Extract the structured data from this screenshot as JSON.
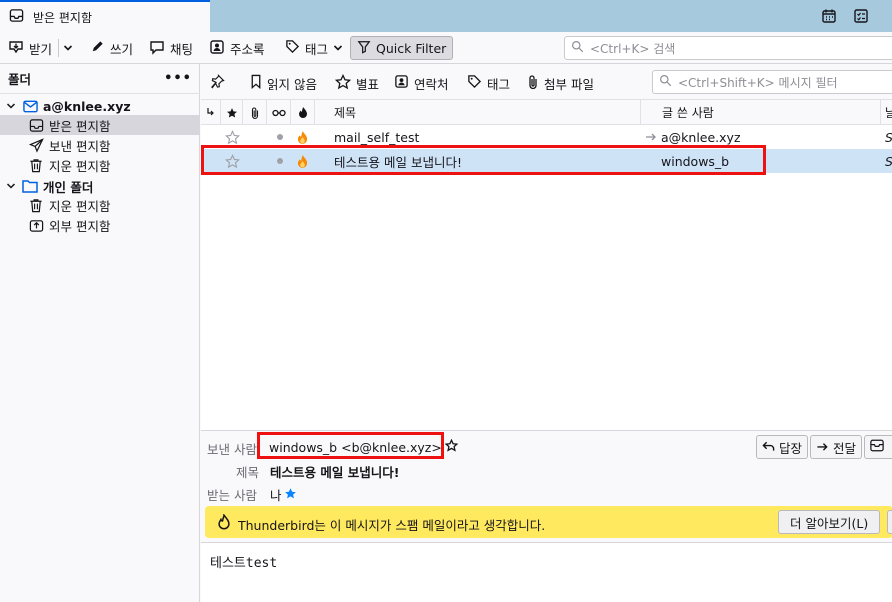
{
  "tab": {
    "title": "받은 편지함"
  },
  "toolbar": {
    "get_label": "받기",
    "write_label": "쓰기",
    "chat_label": "채팅",
    "addressbook_label": "주소록",
    "tag_label": "태그",
    "quickfilter_label": "Quick Filter",
    "search_placeholder": "<Ctrl+K> 검색"
  },
  "folder_pane": {
    "header": "폴더",
    "more": "•••",
    "accounts": [
      {
        "name": "a@knlee.xyz",
        "folders": [
          "받은 편지함",
          "보낸 편지함",
          "지운 편지함"
        ]
      },
      {
        "name": "개인 폴더",
        "folders": [
          "지운 편지함",
          "외부 편지함"
        ]
      }
    ]
  },
  "message_toolbar": {
    "unread_label": "읽지 않음",
    "starred_label": "별표",
    "contact_label": "연락처",
    "tag_label": "태그",
    "attachment_label": "첨부 파일",
    "filter_placeholder": "<Ctrl+Shift+K> 메시지 필터"
  },
  "columns": {
    "subject": "제목",
    "author": "글 쓴 사람",
    "date_partial": "날"
  },
  "messages": [
    {
      "subject": "mail_self_test",
      "author": "a@knlee.xyz",
      "date_partial": "S",
      "outgoing": true
    },
    {
      "subject": "테스트용 메일 보냅니다!",
      "author": "windows_b",
      "date_partial": "S",
      "outgoing": false
    }
  ],
  "preview": {
    "from_label": "보낸 사람",
    "from_value": "windows_b <b@knlee.xyz>",
    "subject_label": "제목",
    "subject_value": "테스트용 메일 보냅니다!",
    "to_label": "받는 사람",
    "to_value": "나",
    "reply_label": "답장",
    "forward_label": "전달",
    "junk_text": "Thunderbird는 이 메시지가 스팸 메일이라고 생각합니다.",
    "learn_more_label": "더 알아보기(L)",
    "body_text": "테스트test"
  },
  "colors": {
    "accent": "#0060df",
    "selected_row": "#cfe3f6",
    "junk_bar": "#ffe95e",
    "highlight_box": "#ee1111"
  }
}
